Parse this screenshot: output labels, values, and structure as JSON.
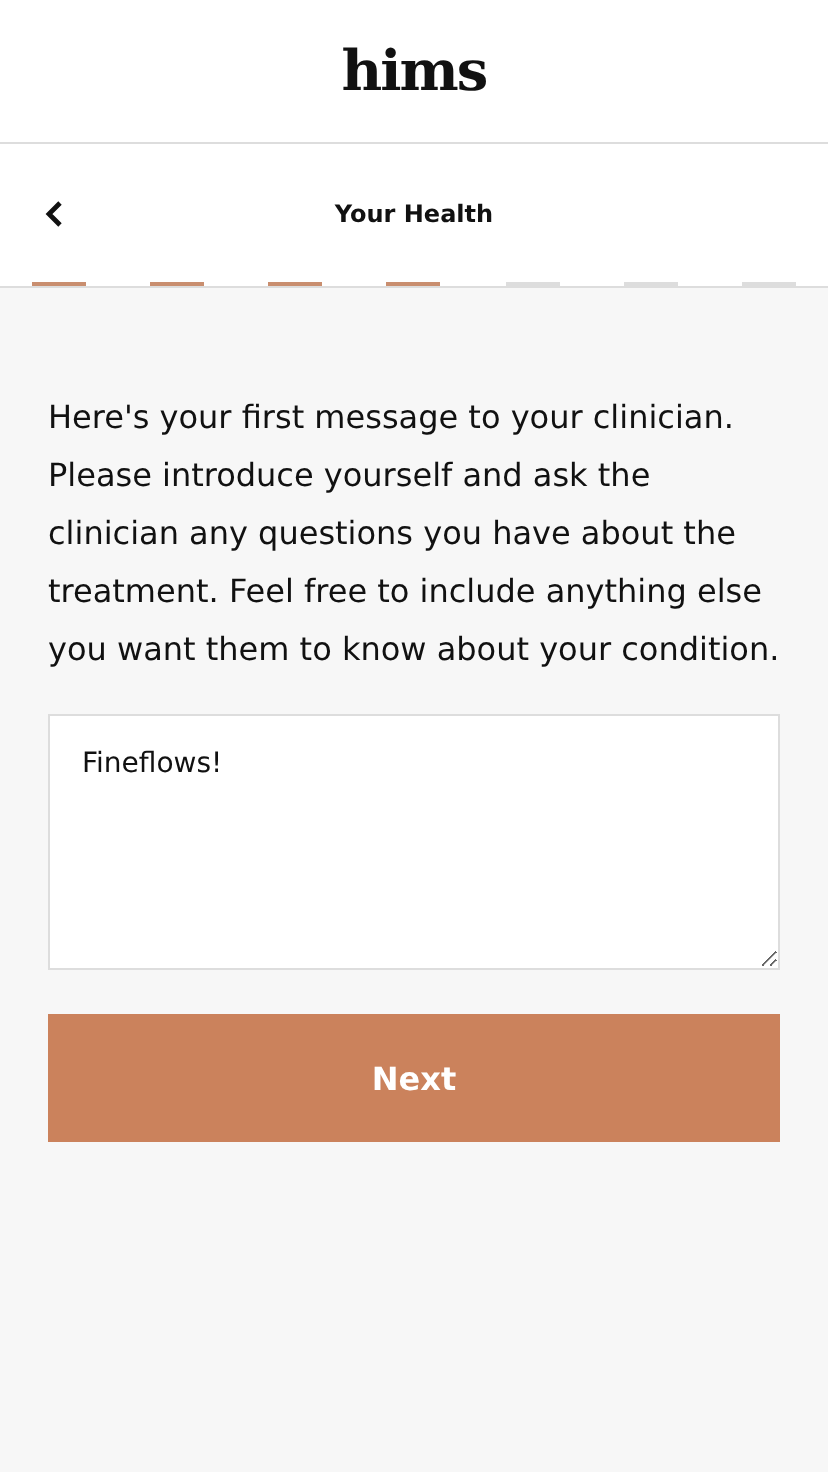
{
  "header": {
    "logo": "hims"
  },
  "nav": {
    "title": "Your Health"
  },
  "steps": [
    {
      "done": true
    },
    {
      "done": true
    },
    {
      "done": true
    },
    {
      "done": true
    },
    {
      "done": false
    },
    {
      "done": false
    },
    {
      "done": false
    }
  ],
  "prompt": "Here's your first message to your clinician. Please introduce yourself and ask the clinician any questions you have about the treatment. Feel free to include anything else you want them to know about your condition.",
  "message": {
    "value": "Fineflows!"
  },
  "next_button": "Next"
}
